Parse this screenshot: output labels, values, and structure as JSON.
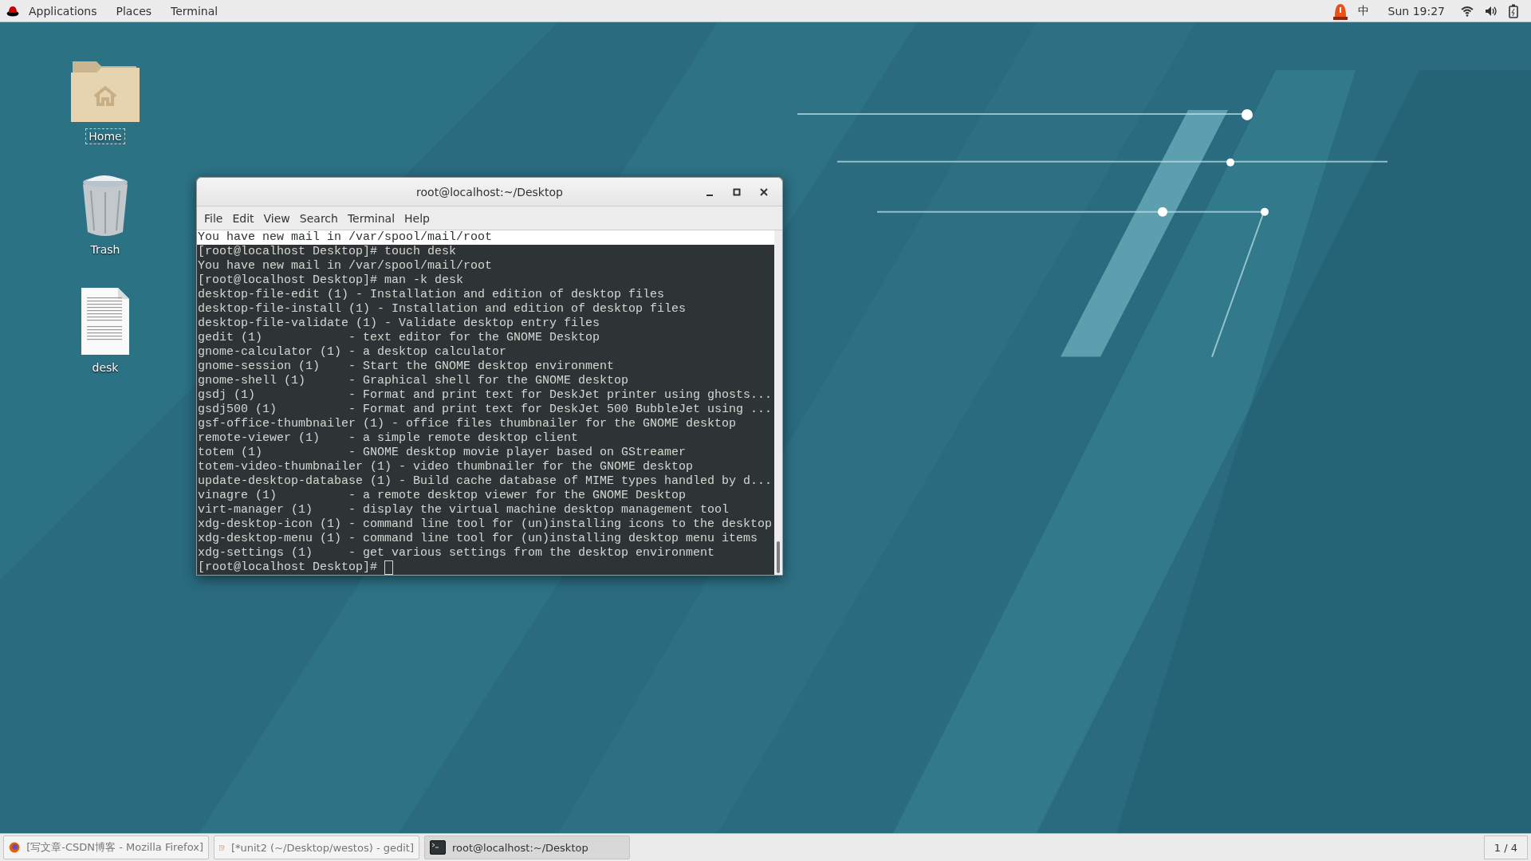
{
  "top_bar": {
    "menus": [
      "Applications",
      "Places",
      "Terminal"
    ],
    "input_method": "中",
    "clock": "Sun 19:27"
  },
  "desktop_icons": [
    {
      "kind": "folder",
      "label": "Home",
      "selected": true
    },
    {
      "kind": "trash",
      "label": "Trash",
      "selected": false
    },
    {
      "kind": "document",
      "label": "desk",
      "selected": false
    }
  ],
  "window": {
    "title": "root@localhost:~/Desktop",
    "menu": [
      "File",
      "Edit",
      "View",
      "Search",
      "Terminal",
      "Help"
    ],
    "lines": [
      {
        "text": "You have new mail in /var/spool/mail/root",
        "highlighted": true
      },
      {
        "text": "[root@localhost Desktop]# touch desk",
        "highlighted": false
      },
      {
        "text": "You have new mail in /var/spool/mail/root",
        "highlighted": false
      },
      {
        "text": "[root@localhost Desktop]# man -k desk",
        "highlighted": false
      },
      {
        "text": "desktop-file-edit (1) - Installation and edition of desktop files",
        "highlighted": false
      },
      {
        "text": "desktop-file-install (1) - Installation and edition of desktop files",
        "highlighted": false
      },
      {
        "text": "desktop-file-validate (1) - Validate desktop entry files",
        "highlighted": false
      },
      {
        "text": "gedit (1)            - text editor for the GNOME Desktop",
        "highlighted": false
      },
      {
        "text": "gnome-calculator (1) - a desktop calculator",
        "highlighted": false
      },
      {
        "text": "gnome-session (1)    - Start the GNOME desktop environment",
        "highlighted": false
      },
      {
        "text": "gnome-shell (1)      - Graphical shell for the GNOME desktop",
        "highlighted": false
      },
      {
        "text": "gsdj (1)             - Format and print text for DeskJet printer using ghosts...",
        "highlighted": false
      },
      {
        "text": "gsdj500 (1)          - Format and print text for DeskJet 500 BubbleJet using ...",
        "highlighted": false
      },
      {
        "text": "gsf-office-thumbnailer (1) - office files thumbnailer for the GNOME desktop",
        "highlighted": false
      },
      {
        "text": "remote-viewer (1)    - a simple remote desktop client",
        "highlighted": false
      },
      {
        "text": "totem (1)            - GNOME desktop movie player based on GStreamer",
        "highlighted": false
      },
      {
        "text": "totem-video-thumbnailer (1) - video thumbnailer for the GNOME desktop",
        "highlighted": false
      },
      {
        "text": "update-desktop-database (1) - Build cache database of MIME types handled by d...",
        "highlighted": false
      },
      {
        "text": "vinagre (1)          - a remote desktop viewer for the GNOME Desktop",
        "highlighted": false
      },
      {
        "text": "virt-manager (1)     - display the virtual machine desktop management tool",
        "highlighted": false
      },
      {
        "text": "xdg-desktop-icon (1) - command line tool for (un)installing icons to the desktop",
        "highlighted": false
      },
      {
        "text": "xdg-desktop-menu (1) - command line tool for (un)installing desktop menu items",
        "highlighted": false
      },
      {
        "text": "xdg-settings (1)     - get various settings from the desktop environment",
        "highlighted": false
      }
    ],
    "prompt": "[root@localhost Desktop]#"
  },
  "taskbar": {
    "tasks": [
      {
        "kind": "browser",
        "label": "[写文章-CSDN博客 - Mozilla Firefox]",
        "selected": false
      },
      {
        "kind": "editor",
        "label": "[*unit2 (~/Desktop/westos) - gedit]",
        "selected": false
      },
      {
        "kind": "terminal",
        "label": "root@localhost:~/Desktop",
        "selected": true
      }
    ],
    "workspace": "1 / 4"
  }
}
